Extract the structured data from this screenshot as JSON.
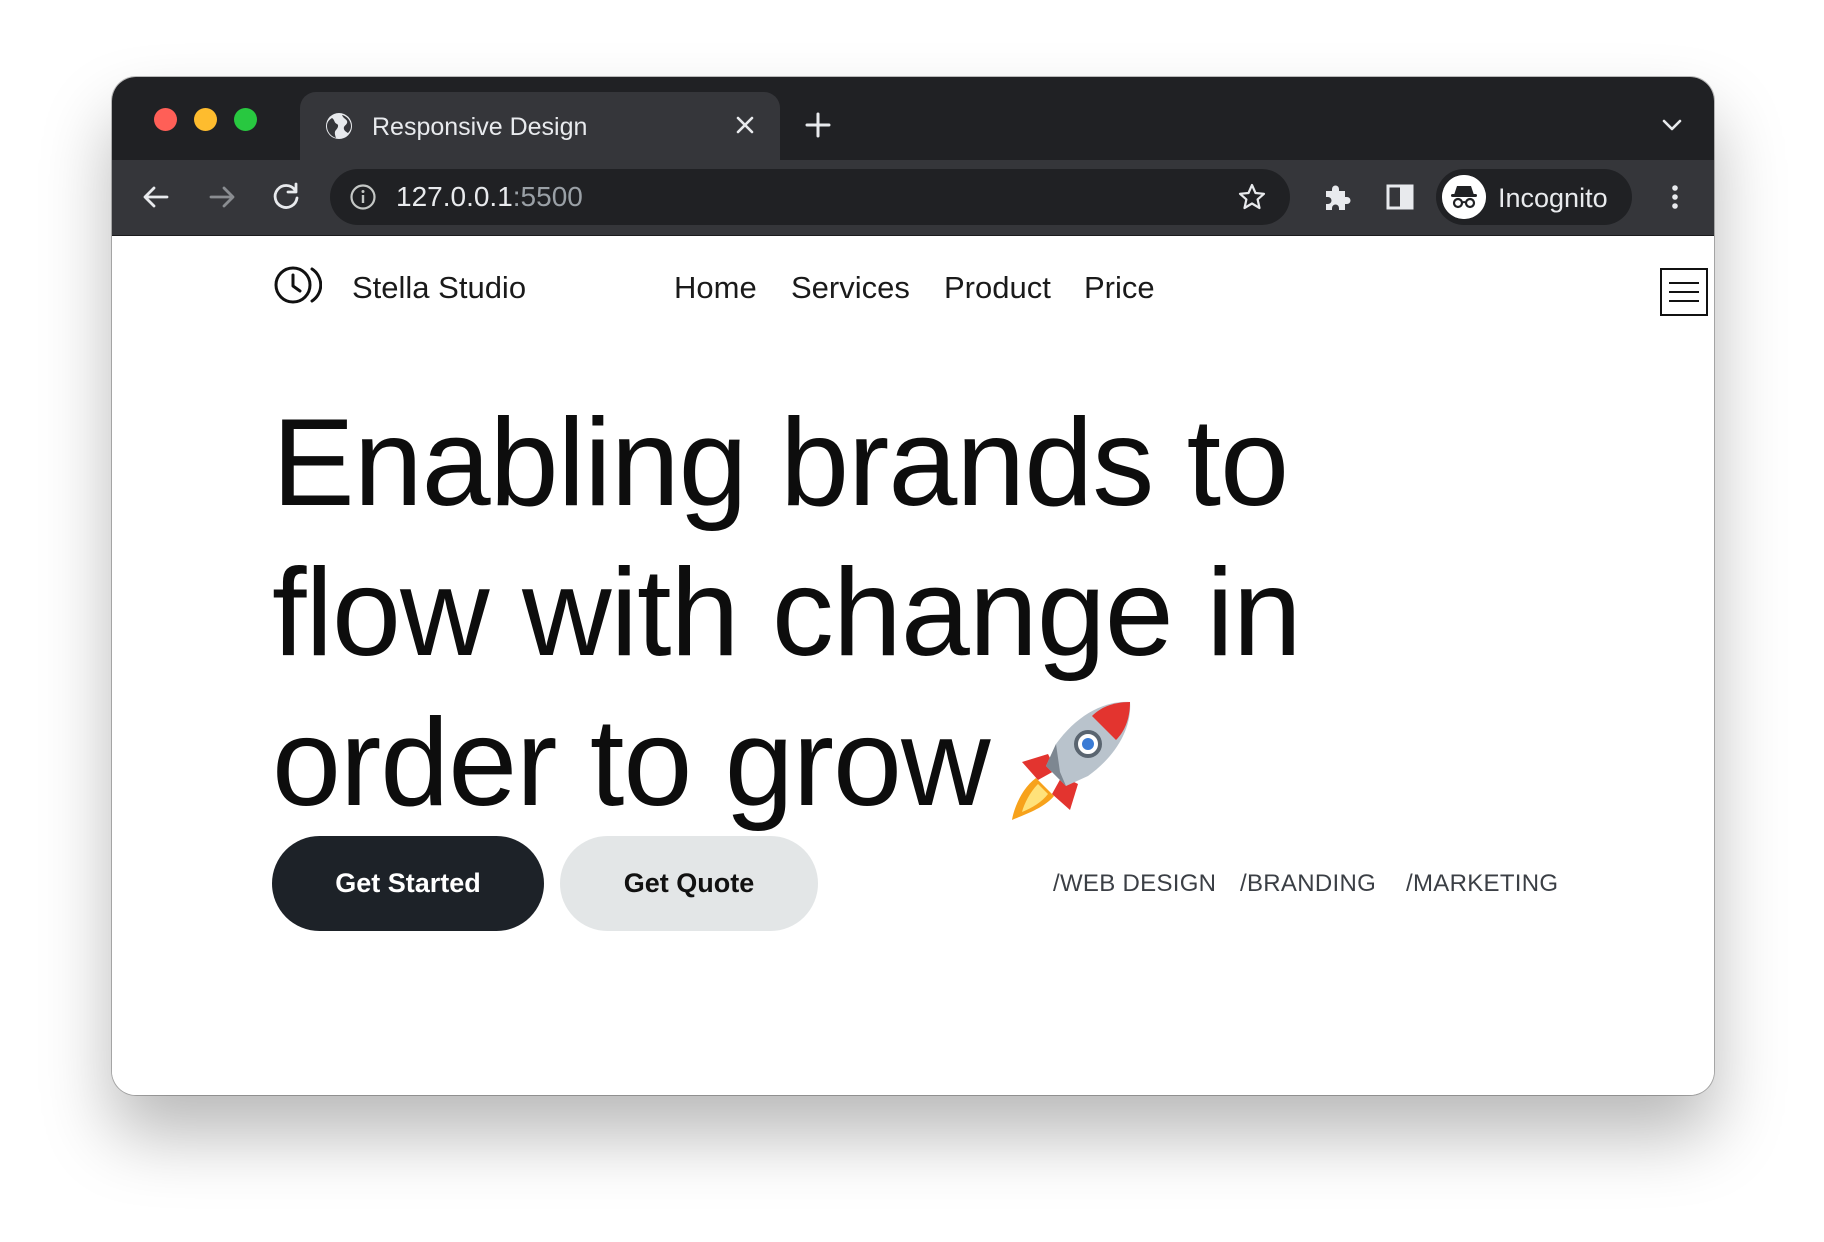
{
  "browser": {
    "tab_title": "Responsive Design",
    "url_host": "127.0.0.1",
    "url_port": ":5500",
    "profile_label": "Incognito",
    "icons": {
      "tab_favicon": "globe-icon",
      "tab_close": "close-icon",
      "new_tab": "plus-icon",
      "tab_search": "chevron-down-icon",
      "back": "arrow-left-icon",
      "forward": "arrow-right-icon",
      "reload": "reload-icon",
      "site_info": "info-icon",
      "bookmark": "star-icon",
      "extensions": "puzzle-icon",
      "side_panel": "side-panel-icon",
      "profile": "incognito-icon",
      "menu": "more-vertical-icon"
    },
    "colors": {
      "tab_strip": "#202124",
      "toolbar": "#35363a",
      "traffic_red": "#ff5f57",
      "traffic_yellow": "#febc2e",
      "traffic_green": "#28c840"
    }
  },
  "site": {
    "brand": "Stella Studio",
    "nav": [
      "Home",
      "Services",
      "Product",
      "Price"
    ],
    "hero": {
      "line1": "Enabling brands to",
      "line2": "flow with change in",
      "line3": "order to grow"
    },
    "buttons": {
      "primary": "Get Started",
      "secondary": "Get Quote"
    },
    "tags": [
      "/WEB DESIGN",
      "/BRANDING",
      "/MARKETING"
    ],
    "colors": {
      "primary_button": "#1d2228",
      "secondary_button": "#e3e6e7",
      "text": "#0d0d0d"
    }
  }
}
